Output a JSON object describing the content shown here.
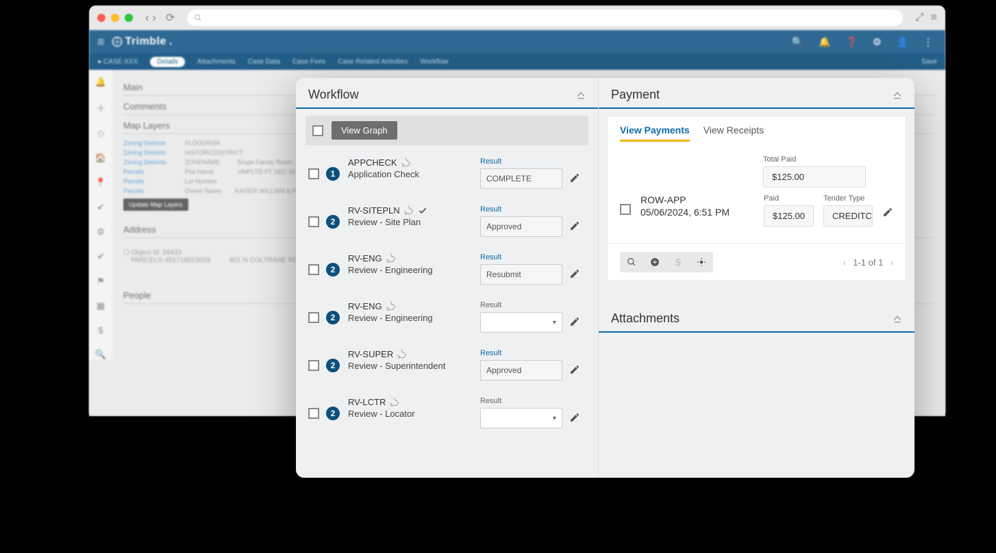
{
  "browser": {
    "search_placeholder": ""
  },
  "app": {
    "brand": "Trimble",
    "tabs": [
      "Details",
      "Attachments",
      "Case Data",
      "Case Fees",
      "Case Related Activities",
      "Workflow"
    ],
    "save_label": "Save",
    "sections": {
      "main": "Main",
      "comments": "Comments",
      "map_layers": "Map Layers",
      "address": "Address",
      "people": "People"
    },
    "update_btn": "Update Map Layers"
  },
  "workflow": {
    "title": "Workflow",
    "view_graph": "View Graph",
    "items": [
      {
        "num": "1",
        "code": "APPCHECK",
        "desc": "Application Check",
        "result_label": "Result",
        "result": "COMPLETE",
        "result_style": "link",
        "has_comment": true,
        "has_check": false,
        "result_filled": true
      },
      {
        "num": "2",
        "code": "RV-SITEPLN",
        "desc": "Review - Site Plan",
        "result_label": "Result",
        "result": "Approved",
        "result_style": "link",
        "has_comment": true,
        "has_check": true,
        "result_filled": true
      },
      {
        "num": "2",
        "code": "RV-ENG",
        "desc": "Review - Engineering",
        "result_label": "Result",
        "result": "Resubmit",
        "result_style": "link",
        "has_comment": true,
        "has_check": false,
        "result_filled": true
      },
      {
        "num": "2",
        "code": "RV-ENG",
        "desc": "Review - Engineering",
        "result_label": "Result",
        "result": "",
        "result_style": "plain",
        "has_comment": true,
        "has_check": false,
        "result_filled": false
      },
      {
        "num": "2",
        "code": "RV-SUPER",
        "desc": "Review - Superintendent",
        "result_label": "Result",
        "result": "Approved",
        "result_style": "link",
        "has_comment": true,
        "has_check": false,
        "result_filled": true
      },
      {
        "num": "2",
        "code": "RV-LCTR",
        "desc": "Review - Locator",
        "result_label": "Result",
        "result": "",
        "result_style": "plain",
        "has_comment": true,
        "has_check": false,
        "result_filled": false
      }
    ]
  },
  "payment": {
    "title": "Payment",
    "tabs": {
      "view_payments": "View Payments",
      "view_receipts": "View Receipts"
    },
    "total_paid_label": "Total Paid",
    "total_paid": "$125.00",
    "rows": [
      {
        "code": "ROW-APP",
        "date": "05/06/2024, 6:51 PM",
        "paid_label": "Paid",
        "paid": "$125.00",
        "tender_label": "Tender Type",
        "tender": "CREDITCARD"
      }
    ],
    "pager": "1-1 of 1"
  },
  "attachments": {
    "title": "Attachments"
  }
}
